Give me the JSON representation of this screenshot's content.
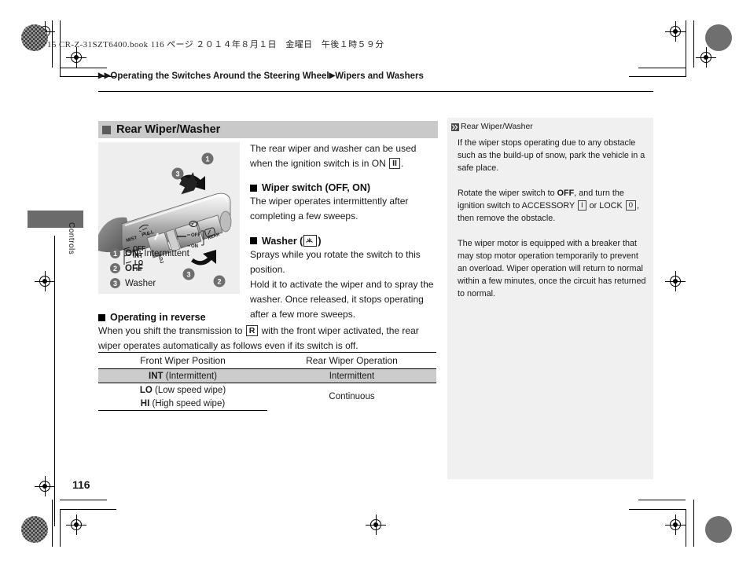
{
  "print_marks": {
    "file_line": "15 CR-Z-31SZT6400.book  116 ページ  ２０１４年８月１日　金曜日　午後１時５９分"
  },
  "breadcrumb": {
    "arrow": "▶",
    "item1": "Operating the Switches Around the Steering Wheel",
    "item2": "Wipers and Washers"
  },
  "tab": {
    "label": "Controls"
  },
  "page": {
    "number": "116"
  },
  "section": {
    "title": "Rear Wiper/Washer"
  },
  "illustration": {
    "stalk_labels": {
      "mist": "MIST",
      "pull": "PULL",
      "off": "OFF",
      "int": "INT",
      "lo": "LO",
      "hi": "HI",
      "adj": "ADJ",
      "rear_off": "OFF",
      "rear_on": "ON",
      "rear": "REAR"
    },
    "callouts": [
      "1",
      "2",
      "3"
    ]
  },
  "legend": {
    "items": [
      {
        "num": "1",
        "bold": "ON:",
        "rest": " Intermittent"
      },
      {
        "num": "2",
        "bold": "OFF",
        "rest": ""
      },
      {
        "num": "3",
        "bold": "",
        "rest": "Washer"
      }
    ]
  },
  "main": {
    "intro_a": "The rear wiper and washer can be used when the ignition switch is in ON ",
    "intro_ignition_box": "II",
    "intro_b": ".",
    "wiper_switch_heading": "Wiper switch (OFF, ON)",
    "wiper_switch_body": "The wiper operates intermittently after completing a few sweeps.",
    "washer_heading_pre": "Washer (",
    "washer_heading_post": ")",
    "washer_body": "Sprays while you rotate the switch to this position.\nHold it to activate the wiper and to spray the washer. Once released, it stops operating after a few more sweeps.",
    "reverse_heading": "Operating in reverse",
    "reverse_body_a": "When you shift the transmission to ",
    "reverse_gear_box": "R",
    "reverse_body_b": " with the front wiper activated, the rear wiper operates automatically as follows even if its switch is off."
  },
  "table": {
    "headers": [
      "Front Wiper Position",
      "Rear Wiper Operation"
    ],
    "rows": [
      {
        "pos_bold": "INT",
        "pos_rest": " (Intermittent)",
        "op": "Intermittent"
      },
      {
        "pos_bold": "LO",
        "pos_rest": " (Low speed wipe)",
        "op": "Continuous"
      },
      {
        "pos_bold": "HI",
        "pos_rest": " (High speed wipe)",
        "op": ""
      }
    ]
  },
  "notes": {
    "title": "Rear Wiper/Washer",
    "p1": "If the wiper stops operating due to any obstacle such as the build-up of snow, park the vehicle in a safe place.",
    "p2_a": "Rotate the wiper switch to ",
    "p2_off": "OFF",
    "p2_b": ", and turn the ignition switch to ACCESSORY ",
    "p2_acc_box": "I",
    "p2_c": " or LOCK ",
    "p2_lock_box": "0",
    "p2_d": ", then remove the obstacle.",
    "p3": "The wiper motor is equipped with a breaker that may stop motor operation temporarily to prevent an overload. Wiper operation will return to normal within a few minutes, once the circuit has returned to normal."
  },
  "colors": {
    "heading_bar": "#c9c9c9",
    "tab_bar": "#6b6b6b",
    "notes_panel": "#f0f0f0",
    "table_shade": "#cccccc",
    "badge": "#6e6e6e"
  }
}
